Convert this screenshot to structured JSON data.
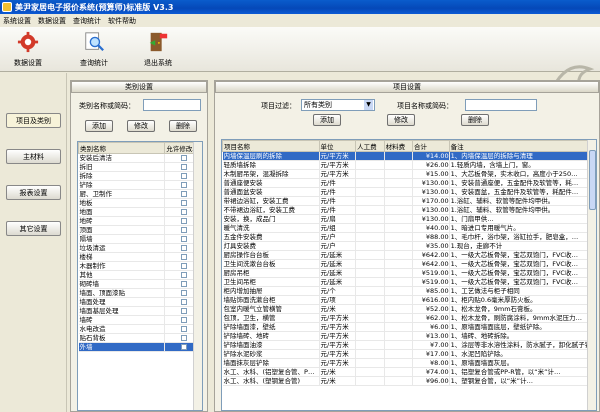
{
  "window": {
    "title": "美尹家居电子报价系统(预算师)标准版 V3.3"
  },
  "menu": [
    "系统设置",
    "数据设置",
    "查询统计",
    "软件帮助"
  ],
  "toolbar": [
    {
      "label": "数据设置",
      "icon": "gear-icon"
    },
    {
      "label": "查询统计",
      "icon": "magnifier-icon"
    },
    {
      "label": "退出系统",
      "icon": "exit-door-icon"
    }
  ],
  "sidebar": [
    "项目及类别",
    "主材料",
    "报表设置",
    "其它设置"
  ],
  "category_panel": {
    "header": "类别设置",
    "name_label": "类别名称或简码：",
    "name_value": "",
    "add": "添加",
    "edit": "修改",
    "delete": "删除",
    "columns": [
      "类别名称",
      "允许修改单价"
    ],
    "items": [
      "安装后清洁",
      "拆旧",
      "拆除",
      "铲除",
      "厨、卫制作",
      "地板",
      "地面",
      "地砖",
      "顶面",
      "隔墙",
      "垃圾清运",
      "楼梯",
      "木器制作",
      "其他",
      "砌砖墙",
      "墙面、顶面漆贴",
      "墙面处理",
      "墙面基层处理",
      "墙砖",
      "水电改造",
      "贴石背板",
      "外墙"
    ],
    "selected_index": 21
  },
  "project_panel": {
    "header": "项目设置",
    "filter_label": "项目过滤：",
    "filter_value": "所有类别",
    "name_label": "项目名称或简码：",
    "name_value": "",
    "add": "添加",
    "edit": "修改",
    "delete": "删除",
    "columns": [
      "项目名称",
      "单位",
      "人工费",
      "材料费",
      "合计",
      "备注"
    ],
    "rows": [
      [
        "内墙保温层刷的拆除",
        "元/平方米",
        "",
        "",
        "¥14.00",
        "1、内墙保温层的拆除与清理"
      ],
      [
        "轻质墙拆除",
        "元/平方米",
        "",
        "",
        "¥26.00",
        "1.轻质内墙，含墙上门，窗。"
      ],
      [
        "木制厨吊架，混凝拆除",
        "元/平方米",
        "",
        "",
        "¥15.00",
        "1、大芯板骨架，实木收口，高度小于250…"
      ],
      [
        "普通座便安装",
        "元/件",
        "",
        "",
        "¥130.00",
        "1、安装普通座便，五金配件及软管等，耗…"
      ],
      [
        "普通面盆安装",
        "元/件",
        "",
        "",
        "¥130.00",
        "1、安装面盆，五金配件及软管等，耗配件…"
      ],
      [
        "带裙边浴缸，安装工费",
        "元/件",
        "",
        "",
        "¥170.00",
        "1.浴缸、辅料、软管等配件均甲供。"
      ],
      [
        "不带裙边浴缸，安装工费",
        "元/件",
        "",
        "",
        "¥130.00",
        "1.浴缸、辅料、软管等配件均甲供。"
      ],
      [
        "安装，换，成品门",
        "元/扇",
        "",
        "",
        "¥130.00",
        "1、门扇甲供…"
      ],
      [
        "暖气清洗",
        "元/组",
        "",
        "",
        "¥40.00",
        "1、暗进口专用暖气片。"
      ],
      [
        "五金件安装费",
        "元/户",
        "",
        "",
        "¥88.00",
        "1、毛巾杆，浴巾架，浴缸拉手，肥皂盒，…"
      ],
      [
        "灯具安装费",
        "元/户",
        "",
        "",
        "¥35.00",
        "1.现台，走廊不计"
      ],
      [
        "厨房操作台台板",
        "元/延米",
        "",
        "",
        "¥642.00",
        "1、一级大芯板骨架，宝芯双饱门，FVC收…"
      ],
      [
        "卫生间洗漱台台板",
        "元/延米",
        "",
        "",
        "¥642.00",
        "1、一级大芯板骨架，宝芯双饱门，FVC收…"
      ],
      [
        "厨房吊柜",
        "元/延米",
        "",
        "",
        "¥519.00",
        "1、一级大芯板骨架，宝芯双饱门，FVC收…"
      ],
      [
        "卫生间吊柜",
        "元/延米",
        "",
        "",
        "¥519.00",
        "1、一级大芯板骨架，宝芯双饱门，FVC收…"
      ],
      [
        "柜内增加抽屉",
        "元/个",
        "",
        "",
        "¥85.00",
        "1、工艺做法与柜子相同"
      ],
      [
        "墙贴饰面洗漱台柜",
        "元/项",
        "",
        "",
        "¥616.00",
        "1、柜内贴0.6毫米厚防火板。"
      ],
      [
        "包室内暖气立管横管",
        "元/米",
        "",
        "",
        "¥52.00",
        "1、松木龙骨，9mm石膏板。"
      ],
      [
        "包顶，卫生，横管",
        "元/平方米",
        "",
        "",
        "¥62.00",
        "1、松木龙骨，刷防腐涂料，9mm水泥压力…"
      ],
      [
        "铲除墙面漆，壁纸",
        "元/平方米",
        "",
        "",
        "¥6.00",
        "1、原墙面墙面底层，壁纸铲除。"
      ],
      [
        "铲除墙砖、地砖",
        "元/平方米",
        "",
        "",
        "¥13.00",
        "1、墙砖、地砖拆除。"
      ],
      [
        "铲除墙面油漆",
        "元/平方米",
        "",
        "",
        "¥7.00",
        "1、涂层等非水溶性涂料，防水腻子，卸化腻子铲…"
      ],
      [
        "铲除水泥砂浆",
        "元/平方米",
        "",
        "",
        "¥17.00",
        "1、水泥凹陷铲除。"
      ],
      [
        "墙面抹灰层铲除",
        "元/平方米",
        "",
        "",
        "¥8.00",
        "1、原墙面墙面灰层。"
      ],
      [
        "水工、水科、(铝塑复合管、P…",
        "元/米",
        "",
        "",
        "¥74.00",
        "1、铝塑复合管或PP-R管，以“米”计…"
      ],
      [
        "水工、水科、(塑钢复合管)",
        "元/米",
        "",
        "",
        "¥96.00",
        "1、塑钢复合管，以“米”计…"
      ]
    ],
    "selected_index": 0
  },
  "colors": {
    "title": "#0548b8",
    "selection": "#316ac5",
    "bg": "#ece9d8"
  }
}
